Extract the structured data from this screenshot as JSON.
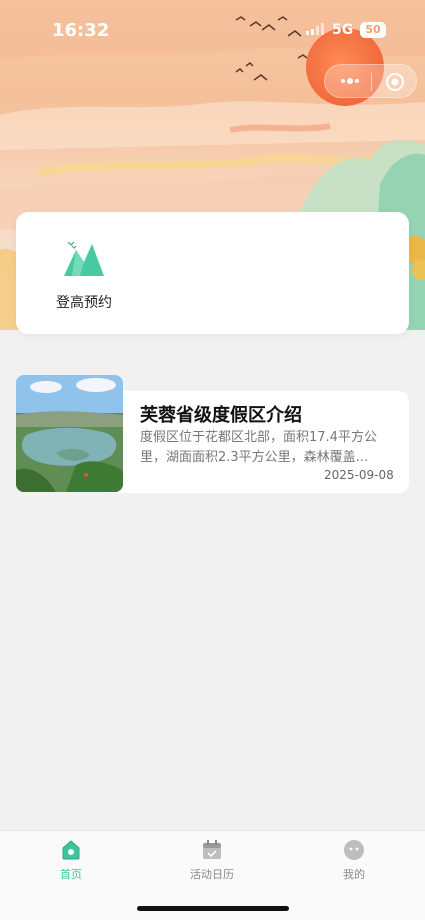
{
  "status_bar": {
    "time": "16:32",
    "network": "5G",
    "battery": "50"
  },
  "entry": {
    "label": "登高预约",
    "icon": "mountain-icon"
  },
  "article": {
    "title": "芙蓉省级度假区介绍",
    "description": "度假区位于花都区北部，面积17.4平方公里，湖面面积2.3平方公里，森林覆盖...",
    "date": "2025-09-08"
  },
  "tabbar": {
    "items": [
      {
        "label": "首页",
        "icon": "home-icon",
        "active": true
      },
      {
        "label": "活动日历",
        "icon": "calendar-icon",
        "active": false
      },
      {
        "label": "我的",
        "icon": "profile-icon",
        "active": false
      }
    ]
  },
  "colors": {
    "accent": "#3ec39b",
    "background": "#f1f1f1",
    "sun": "#f06a3a"
  }
}
